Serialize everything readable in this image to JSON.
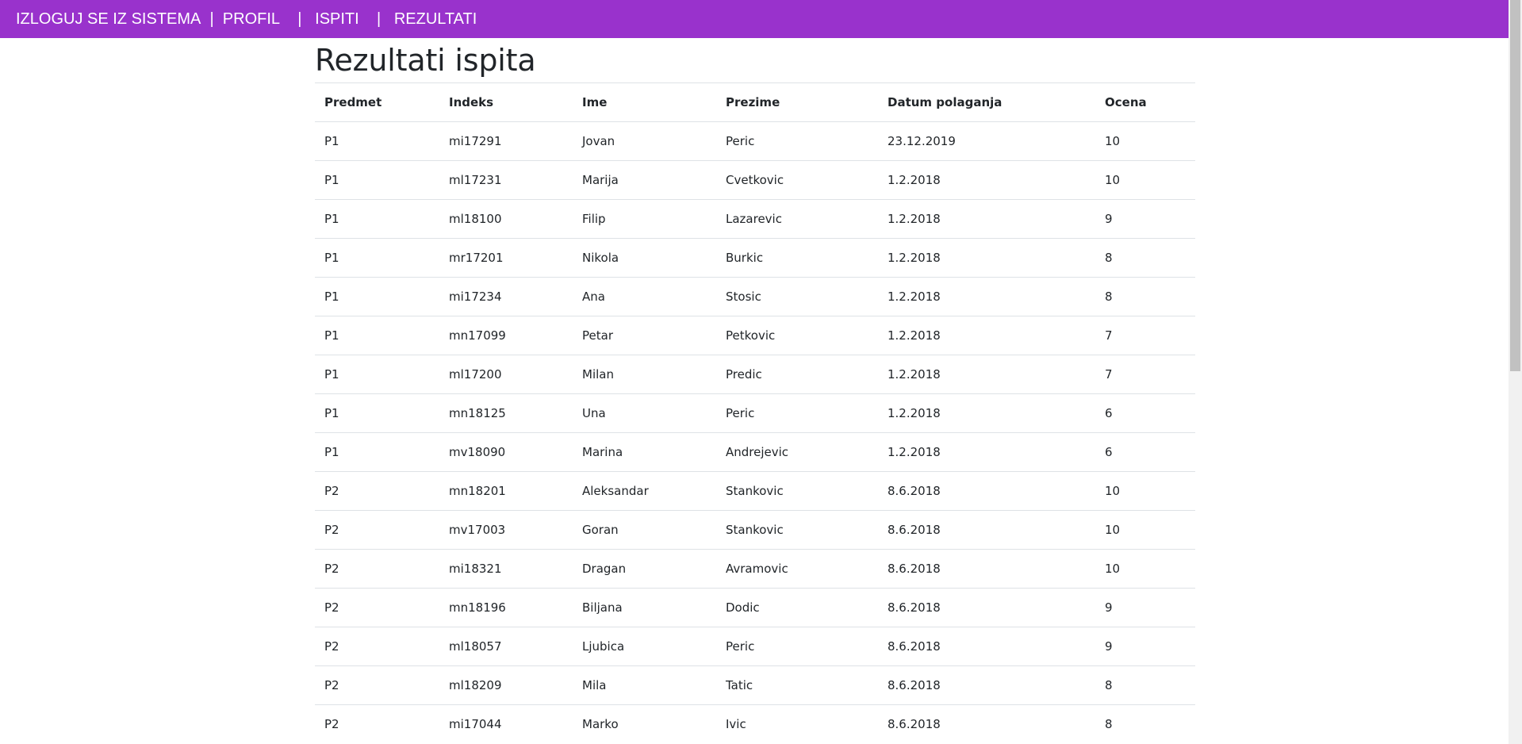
{
  "nav": {
    "logout": "IZLOGUJ SE IZ SISTEMA",
    "sep1": "  |  ",
    "profile": "PROFIL",
    "sep2": "    |   ",
    "exams": "ISPITI",
    "sep3": "    |   ",
    "results": "REZULTATI"
  },
  "page": {
    "title": "Rezultati ispita"
  },
  "table": {
    "headers": [
      "Predmet",
      "Indeks",
      "Ime",
      "Prezime",
      "Datum polaganja",
      "Ocena"
    ],
    "rows": [
      [
        "P1",
        "mi17291",
        "Jovan",
        "Peric",
        "23.12.2019",
        "10"
      ],
      [
        "P1",
        "ml17231",
        "Marija",
        "Cvetkovic",
        "1.2.2018",
        "10"
      ],
      [
        "P1",
        "ml18100",
        "Filip",
        "Lazarevic",
        "1.2.2018",
        "9"
      ],
      [
        "P1",
        "mr17201",
        "Nikola",
        "Burkic",
        "1.2.2018",
        "8"
      ],
      [
        "P1",
        "mi17234",
        "Ana",
        "Stosic",
        "1.2.2018",
        "8"
      ],
      [
        "P1",
        "mn17099",
        "Petar",
        "Petkovic",
        "1.2.2018",
        "7"
      ],
      [
        "P1",
        "ml17200",
        "Milan",
        "Predic",
        "1.2.2018",
        "7"
      ],
      [
        "P1",
        "mn18125",
        "Una",
        "Peric",
        "1.2.2018",
        "6"
      ],
      [
        "P1",
        "mv18090",
        "Marina",
        "Andrejevic",
        "1.2.2018",
        "6"
      ],
      [
        "P2",
        "mn18201",
        "Aleksandar",
        "Stankovic",
        "8.6.2018",
        "10"
      ],
      [
        "P2",
        "mv17003",
        "Goran",
        "Stankovic",
        "8.6.2018",
        "10"
      ],
      [
        "P2",
        "mi18321",
        "Dragan",
        "Avramovic",
        "8.6.2018",
        "10"
      ],
      [
        "P2",
        "mn18196",
        "Biljana",
        "Dodic",
        "8.6.2018",
        "9"
      ],
      [
        "P2",
        "ml18057",
        "Ljubica",
        "Peric",
        "8.6.2018",
        "9"
      ],
      [
        "P2",
        "ml18209",
        "Mila",
        "Tatic",
        "8.6.2018",
        "8"
      ],
      [
        "P2",
        "mi17044",
        "Marko",
        "Ivic",
        "8.6.2018",
        "8"
      ]
    ]
  },
  "colors": {
    "navbar": "#9932cc",
    "nav_text": "#ffffff",
    "text": "#212529",
    "border": "#dee2e6"
  }
}
